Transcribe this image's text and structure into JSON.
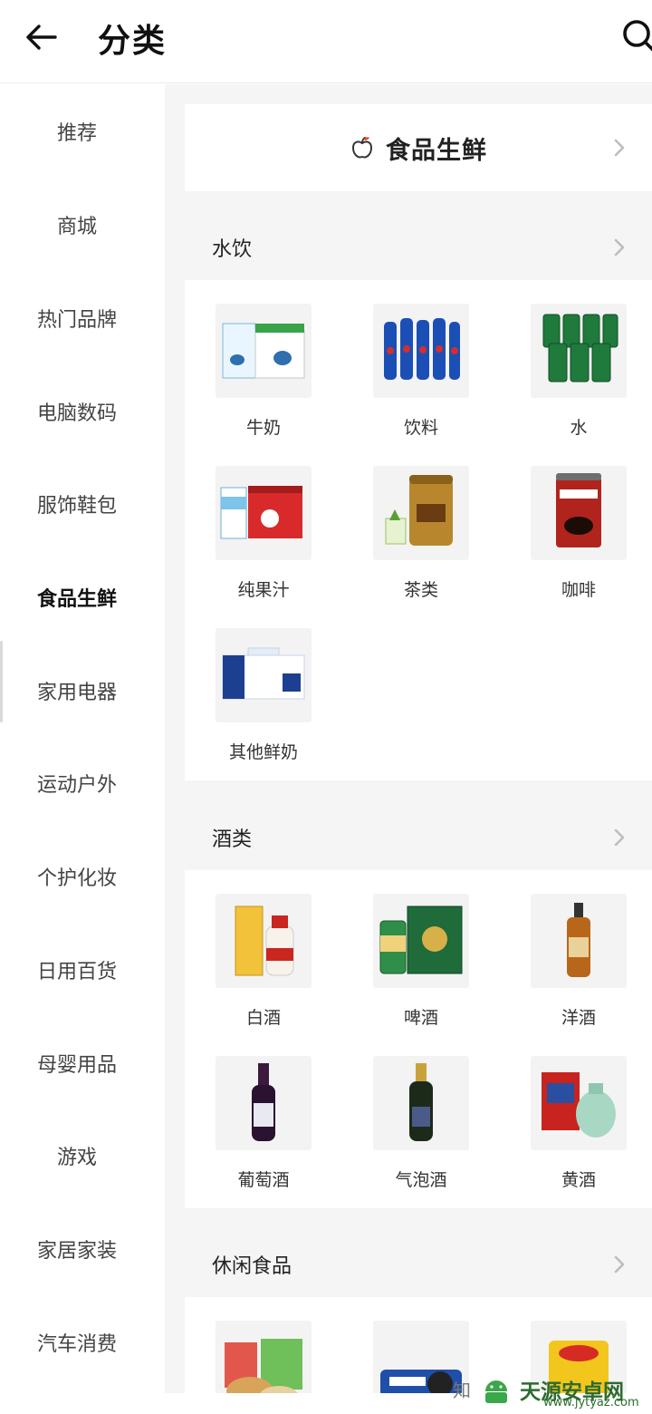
{
  "header": {
    "title": "分类"
  },
  "sidebar": {
    "items": [
      {
        "label": "推荐"
      },
      {
        "label": "商城"
      },
      {
        "label": "热门品牌"
      },
      {
        "label": "电脑数码"
      },
      {
        "label": "服饰鞋包"
      },
      {
        "label": "食品生鲜",
        "active": true
      },
      {
        "label": "家用电器"
      },
      {
        "label": "运动户外"
      },
      {
        "label": "个护化妆"
      },
      {
        "label": "日用百货"
      },
      {
        "label": "母婴用品"
      },
      {
        "label": "游戏"
      },
      {
        "label": "家居家装"
      },
      {
        "label": "汽车消费"
      }
    ]
  },
  "banner": {
    "label": "食品生鲜",
    "icon": "apple-icon"
  },
  "sections": [
    {
      "title": "水饮",
      "items": [
        {
          "label": "牛奶"
        },
        {
          "label": "饮料"
        },
        {
          "label": "水"
        },
        {
          "label": "纯果汁"
        },
        {
          "label": "茶类"
        },
        {
          "label": "咖啡"
        },
        {
          "label": "其他鲜奶"
        }
      ]
    },
    {
      "title": "酒类",
      "items": [
        {
          "label": "白酒"
        },
        {
          "label": "啤酒"
        },
        {
          "label": "洋酒"
        },
        {
          "label": "葡萄酒"
        },
        {
          "label": "气泡酒"
        },
        {
          "label": "黄酒"
        }
      ]
    },
    {
      "title": "休闲食品",
      "items": [
        {
          "label": ""
        },
        {
          "label": ""
        },
        {
          "label": ""
        }
      ]
    }
  ],
  "watermark": {
    "text": "知",
    "logo_text": "天源安卓网",
    "url": "www.jytyaz.com"
  },
  "colors": {
    "accent": "#111111",
    "muted": "#f5f5f5",
    "chevron": "#bdbdbd",
    "watermark": "#2d6b2f"
  }
}
